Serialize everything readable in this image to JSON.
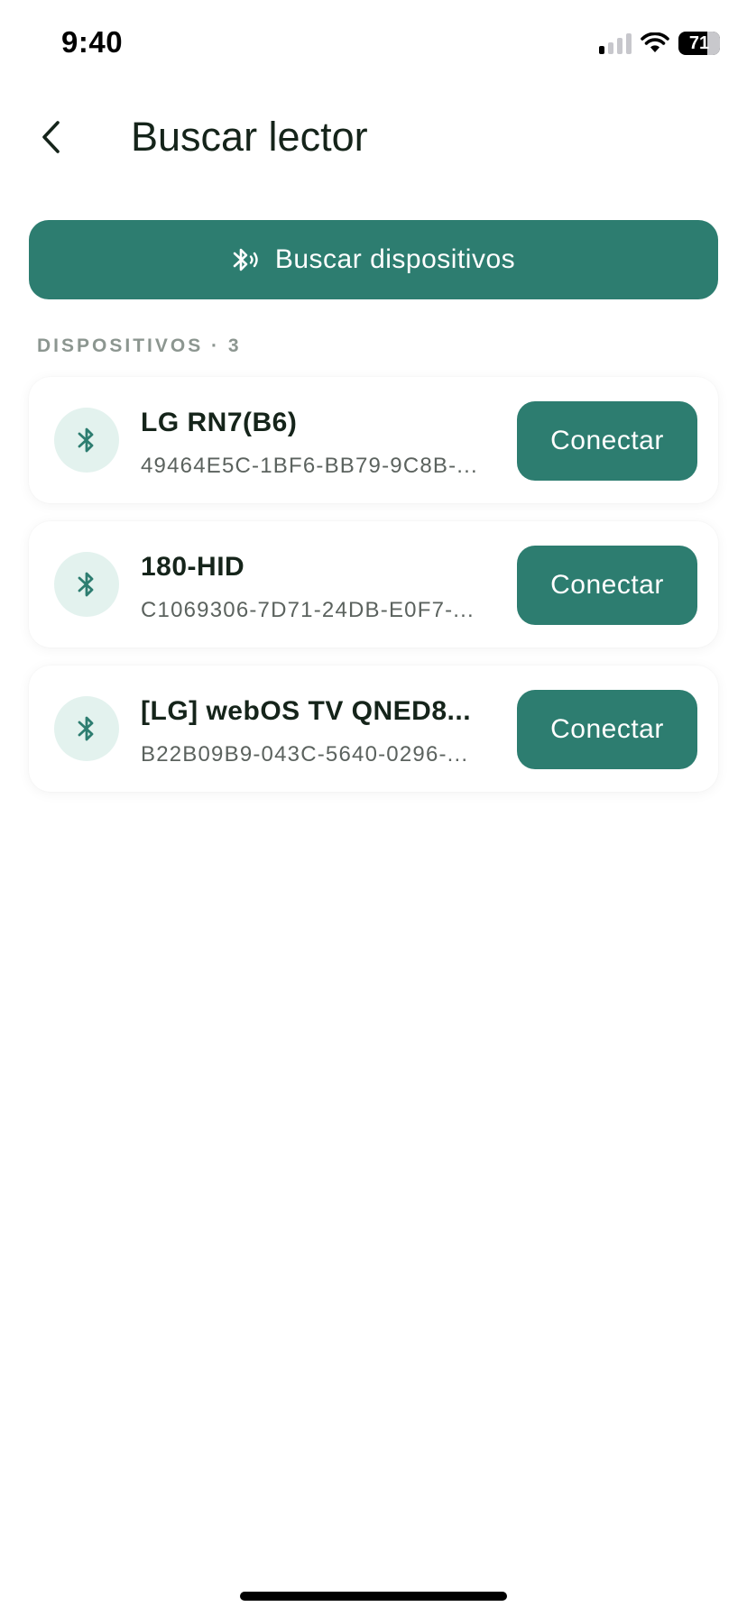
{
  "status_bar": {
    "time": "9:40",
    "battery_level": "71",
    "icons": [
      "cellular-signal-icon",
      "wifi-icon",
      "battery-icon"
    ]
  },
  "header": {
    "back_icon": "chevron-left-icon",
    "title": "Buscar lector"
  },
  "scan_button": {
    "icon": "bluetooth-searching-icon",
    "label": "Buscar dispositivos"
  },
  "devices_section": {
    "label": "DISPOSITIVOS · 3"
  },
  "devices": [
    {
      "icon": "bluetooth-icon",
      "name": "LG RN7(B6)",
      "id": "49464E5C-1BF6-BB79-9C8B-...",
      "button": "Conectar"
    },
    {
      "icon": "bluetooth-icon",
      "name": "180-HID",
      "id": "C1069306-7D71-24DB-E0F7-...",
      "button": "Conectar"
    },
    {
      "icon": "bluetooth-icon",
      "name": "[LG] webOS TV QNED8...",
      "id": "B22B09B9-043C-5640-0296-...",
      "button": "Conectar"
    }
  ],
  "colors": {
    "primary": "#2d7d70",
    "icon_bg": "#e3f2ee",
    "text_dark": "#15241a",
    "text_muted": "#5b625e",
    "section_label": "#8c9690"
  }
}
